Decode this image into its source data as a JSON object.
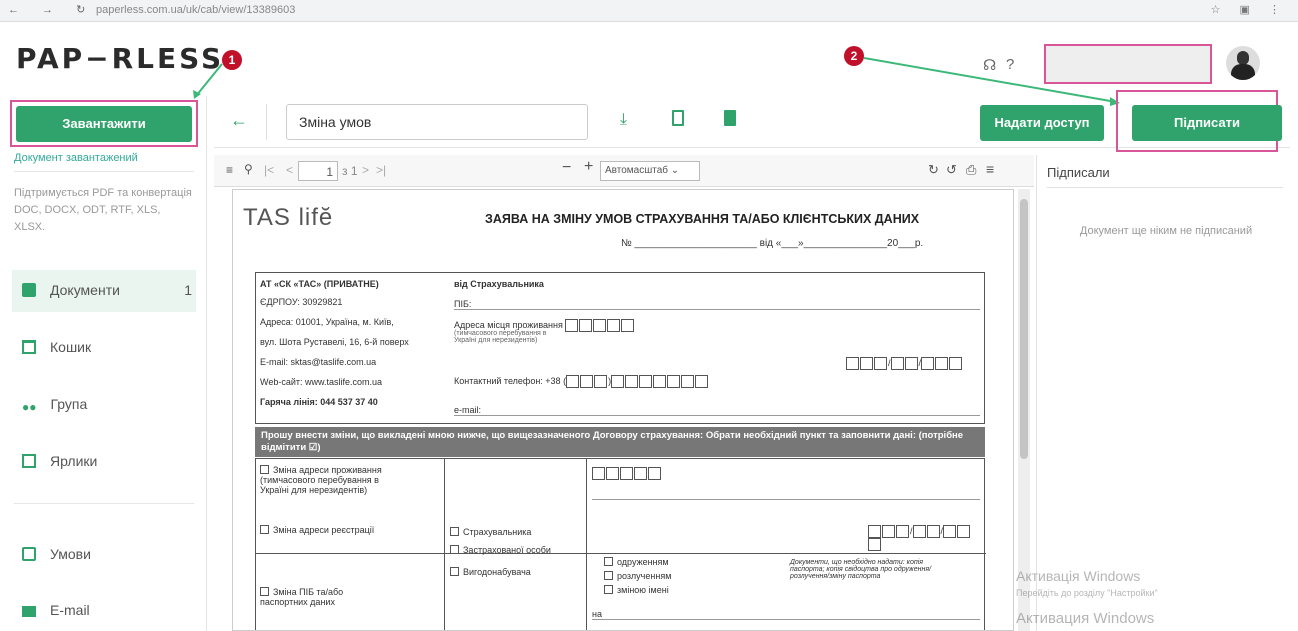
{
  "browser": {
    "url": "paperless.com.ua/uk/cab/view/13389603"
  },
  "app": {
    "logo": "PAP−RLESS"
  },
  "annotations": {
    "badge1": "1",
    "badge2": "2"
  },
  "sidebar": {
    "upload_label": "Завантажити",
    "upload_status": "Документ завантажений",
    "supported_note": "Підтримується PDF та конвертація DOC, DOCX, ODT, RTF, XLS, XLSX.",
    "items": [
      {
        "label": "Документи",
        "count": "1",
        "icon": "document-icon"
      },
      {
        "label": "Кошик",
        "icon": "trash-icon"
      },
      {
        "label": "Група",
        "icon": "group-icon"
      },
      {
        "label": "Ярлики",
        "icon": "bookmark-icon"
      },
      {
        "label": "Умови",
        "icon": "terms-icon"
      },
      {
        "label": "E-mail",
        "icon": "mail-icon"
      }
    ]
  },
  "toolbar": {
    "doc_name": "Зміна умов",
    "share_label": "Надати доступ",
    "sign_label": "Підписати"
  },
  "pdf": {
    "page": "1",
    "page_total": "з 1",
    "zoom": "Автомасштаб"
  },
  "sign_panel": {
    "title": "Підписали",
    "empty": "Документ ще ніким не підписаний"
  },
  "document": {
    "brand": "TAS lifĕ",
    "title": "ЗАЯВА НА ЗМІНУ УМОВ СТРАХУВАННЯ ТА/АБО КЛІЄНТСЬКИХ ДАНИХ",
    "number_line": "№ ______________________ від «___»_______________20___р.",
    "company": "АТ «СК «ТАС» (ПРИВАТНЕ)",
    "edrpou": "ЄДРПОУ: 30929821",
    "address": "Адреса: 01001, Україна, м. Київ,",
    "address2": "вул. Шота Руставелі, 16, 6-й поверх",
    "email": "E-mail: sktas@taslife.com.ua",
    "website": "Web-сайт: www.taslife.com.ua",
    "hotline": "Гаряча лінія: 044 537 37 40",
    "from_insurer": "від Страхувальника",
    "pib": "ПІБ:",
    "residence": "Адреса місця проживання",
    "residence_note": "(тимчасового перебування в Україні для нерезидентів)",
    "phone": "Контактний телефон: +38 (",
    "email_field": "e-mail:",
    "banner": "Прошу внести зміни, що викладені мною нижче, що вищезазначеного Договору страхування: Обрати необхідний пункт та заповнити дані: (потрібне відмітити ☑)",
    "opt1": "Зміна адреси проживання (тимчасового перебування в Україні для нерезидентів)",
    "opt2": "Зміна адреси реєстрації",
    "opt3": "Зміна ПІБ та/або паспортних даних",
    "role1": "Страхувальника",
    "role2": "Застрахованої особи",
    "role3": "Вигодонабувача",
    "reason1": "одруженням",
    "reason2": "розлученням",
    "reason3": "зміною імені",
    "docs_note": "Документи, що необхідно надати: копія паспорта; копія свідоцтва про одруження/розлучення/зміну паспорта",
    "na": "на"
  },
  "watermark": {
    "line1": "Активація Windows",
    "line2": "Перейдіть до розділу \"Настройки\"",
    "line3": "Активация Windows"
  }
}
